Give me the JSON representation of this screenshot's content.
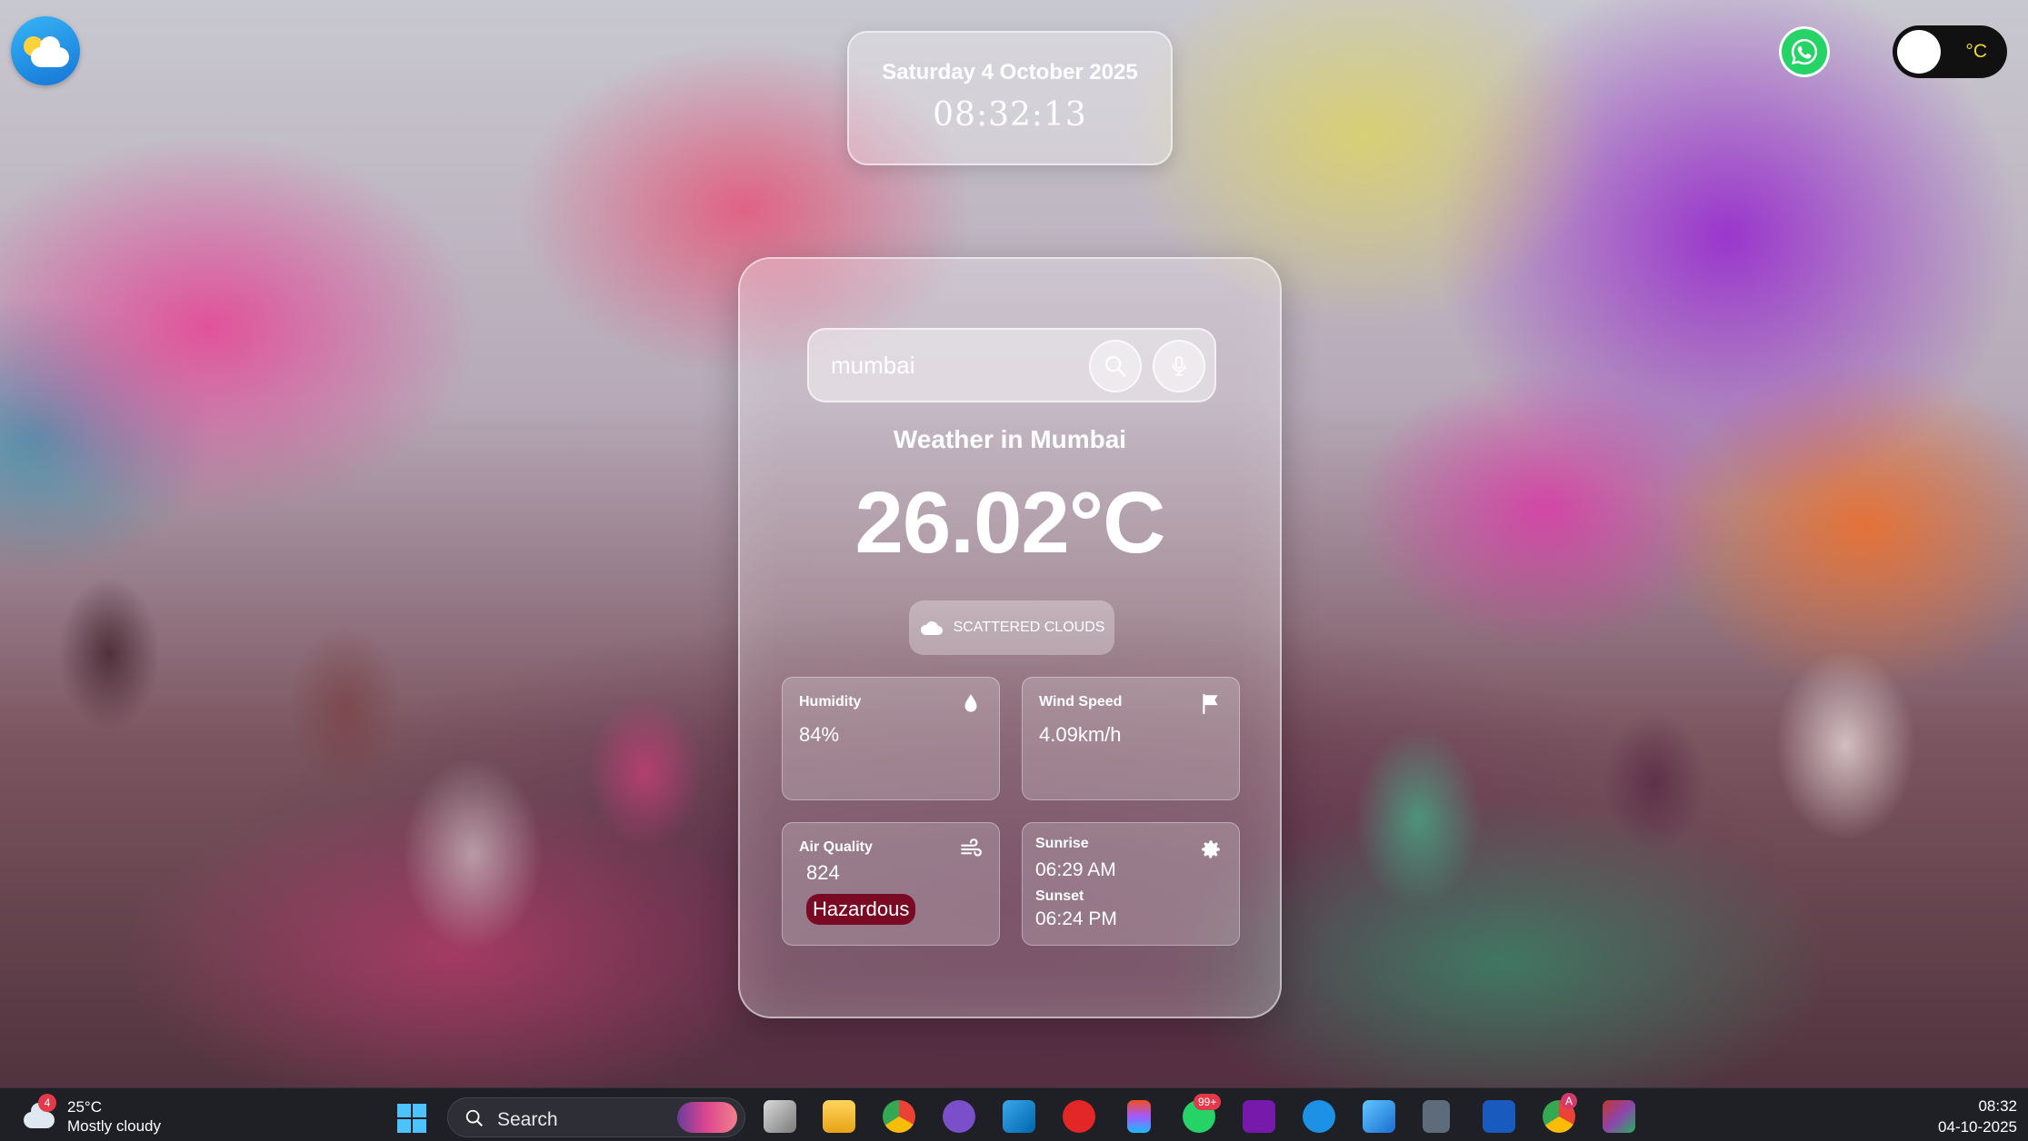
{
  "header": {
    "date": "Saturday 4 October 2025",
    "time": "08:32:13",
    "unit_toggle_label": "°C"
  },
  "search": {
    "value": "mumbai"
  },
  "weather": {
    "title": "Weather in Mumbai",
    "temperature": "26.02°C",
    "condition": "SCATTERED CLOUDS",
    "humidity_label": "Humidity",
    "humidity_value": "84%",
    "wind_label": "Wind Speed",
    "wind_value": "4.09km/h",
    "air_quality_label": "Air Quality",
    "air_quality_value": "824",
    "air_quality_status": "Hazardous",
    "sunrise_label": "Sunrise",
    "sunrise_value": "06:29 AM",
    "sunset_label": "Sunset",
    "sunset_value": "06:24 PM"
  },
  "colors": {
    "toggle_bg": "#111111",
    "toggle_unit": "#f2d820",
    "badge_hazardous": "#7a0a24",
    "whatsapp": "#25d366",
    "taskbar": "#1f1f26"
  },
  "taskbar": {
    "weather_badge": "4",
    "weather_temp": "25°C",
    "weather_condition": "Mostly cloudy",
    "search_placeholder": "Search",
    "whatsapp_badge": "99+",
    "chrome_badge": "A",
    "clock_time": "08:32",
    "clock_date": "04-10-2025",
    "apps": [
      "start-icon",
      "task-view-icon",
      "file-explorer-icon",
      "chrome-icon",
      "github-icon",
      "vscode-icon",
      "youtube-music-icon",
      "figma-icon",
      "whatsapp-icon",
      "onenote-icon",
      "docker-icon",
      "photos-icon",
      "calculator-icon",
      "word-icon",
      "chrome-profile-icon",
      "winrar-icon"
    ]
  }
}
